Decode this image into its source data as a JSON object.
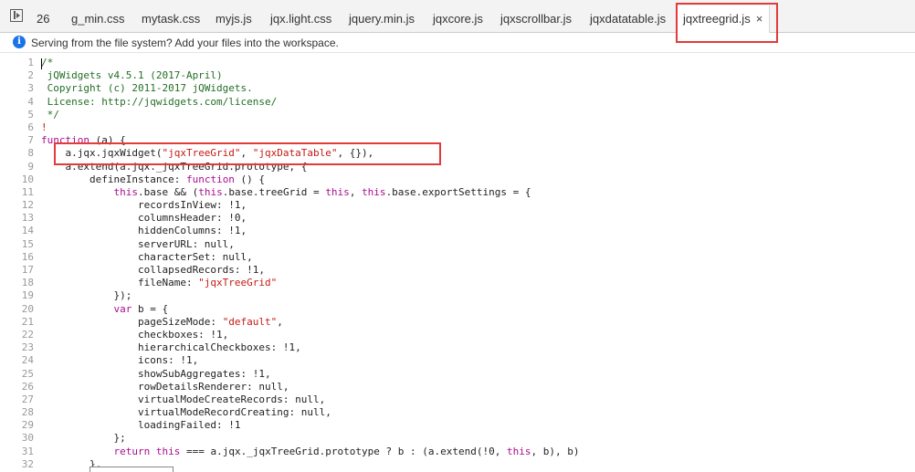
{
  "tabbar": {
    "count": "26",
    "tabs": [
      {
        "label": "g_min.css"
      },
      {
        "label": "mytask.css"
      },
      {
        "label": "myjs.js"
      },
      {
        "label": "jqx.light.css"
      },
      {
        "label": "jquery.min.js"
      },
      {
        "label": "jqxcore.js"
      },
      {
        "label": "jqxscrollbar.js"
      },
      {
        "label": "jqxdatatable.js"
      },
      {
        "label": "jqxtreegrid.js",
        "active": true,
        "close": "×"
      }
    ]
  },
  "infobar": {
    "message": "Serving from the file system? Add your files into the workspace."
  },
  "colors": {
    "highlight_box": "#e23b3b",
    "info_icon": "#1a73e8"
  },
  "code": {
    "line_numbers": [
      "1",
      "2",
      "3",
      "4",
      "5",
      "6",
      "7",
      "8",
      "9",
      "10",
      "11",
      "12",
      "13",
      "14",
      "15",
      "16",
      "17",
      "18",
      "19",
      "20",
      "21",
      "22",
      "23",
      "24",
      "25",
      "26",
      "27",
      "28",
      "29",
      "30",
      "31",
      "32"
    ],
    "lines": [
      [
        {
          "t": "/*",
          "c": "comment"
        }
      ],
      [
        {
          "t": " jQWidgets v4.5.1 (2017-April)",
          "c": "comment"
        }
      ],
      [
        {
          "t": " Copyright (c) 2011-2017 jQWidgets.",
          "c": "comment"
        }
      ],
      [
        {
          "t": " License: http://jqwidgets.com/license/",
          "c": "comment"
        }
      ],
      [
        {
          "t": " */",
          "c": "comment"
        }
      ],
      [
        {
          "t": "!",
          "c": "red"
        }
      ],
      [
        {
          "t": "function",
          "c": "kw"
        },
        {
          "t": " (a) {"
        }
      ],
      [
        {
          "t": "    a.jqx.jqxWidget("
        },
        {
          "t": "\"jqxTreeGrid\"",
          "c": "str"
        },
        {
          "t": ", "
        },
        {
          "t": "\"jqxDataTable\"",
          "c": "str"
        },
        {
          "t": ", {}),"
        }
      ],
      [
        {
          "t": "    a.extend(a.jqx._jqxTreeGrid.prototype, {"
        }
      ],
      [
        {
          "t": "        defineInstance: "
        },
        {
          "t": "function",
          "c": "kw"
        },
        {
          "t": " () {"
        }
      ],
      [
        {
          "t": "            "
        },
        {
          "t": "this",
          "c": "kw"
        },
        {
          "t": ".base && ("
        },
        {
          "t": "this",
          "c": "kw"
        },
        {
          "t": ".base.treeGrid = "
        },
        {
          "t": "this",
          "c": "kw"
        },
        {
          "t": ", "
        },
        {
          "t": "this",
          "c": "kw"
        },
        {
          "t": ".base.exportSettings = {"
        }
      ],
      [
        {
          "t": "                recordsInView: !1,"
        }
      ],
      [
        {
          "t": "                columnsHeader: !0,"
        }
      ],
      [
        {
          "t": "                hiddenColumns: !1,"
        }
      ],
      [
        {
          "t": "                serverURL: null,"
        }
      ],
      [
        {
          "t": "                characterSet: null,"
        }
      ],
      [
        {
          "t": "                collapsedRecords: !1,"
        }
      ],
      [
        {
          "t": "                fileName: "
        },
        {
          "t": "\"jqxTreeGrid\"",
          "c": "str"
        }
      ],
      [
        {
          "t": "            });"
        }
      ],
      [
        {
          "t": "            "
        },
        {
          "t": "var",
          "c": "kw"
        },
        {
          "t": " b = {"
        }
      ],
      [
        {
          "t": "                pageSizeMode: "
        },
        {
          "t": "\"default\"",
          "c": "str"
        },
        {
          "t": ","
        }
      ],
      [
        {
          "t": "                checkboxes: !1,"
        }
      ],
      [
        {
          "t": "                hierarchicalCheckboxes: !1,"
        }
      ],
      [
        {
          "t": "                icons: !1,"
        }
      ],
      [
        {
          "t": "                showSubAggregates: !1,"
        }
      ],
      [
        {
          "t": "                rowDetailsRenderer: null,"
        }
      ],
      [
        {
          "t": "                virtualModeCreateRecords: null,"
        }
      ],
      [
        {
          "t": "                virtualModeRecordCreating: null,"
        }
      ],
      [
        {
          "t": "                loadingFailed: !1"
        }
      ],
      [
        {
          "t": "            };"
        }
      ],
      [
        {
          "t": "            "
        },
        {
          "t": "return",
          "c": "kw"
        },
        {
          "t": " "
        },
        {
          "t": "this",
          "c": "kw"
        },
        {
          "t": " === a.jqx._jqxTreeGrid.prototype ? b : (a.extend(!0, "
        },
        {
          "t": "this",
          "c": "kw"
        },
        {
          "t": ", b), b)"
        }
      ],
      [
        {
          "t": "        },"
        }
      ]
    ]
  }
}
